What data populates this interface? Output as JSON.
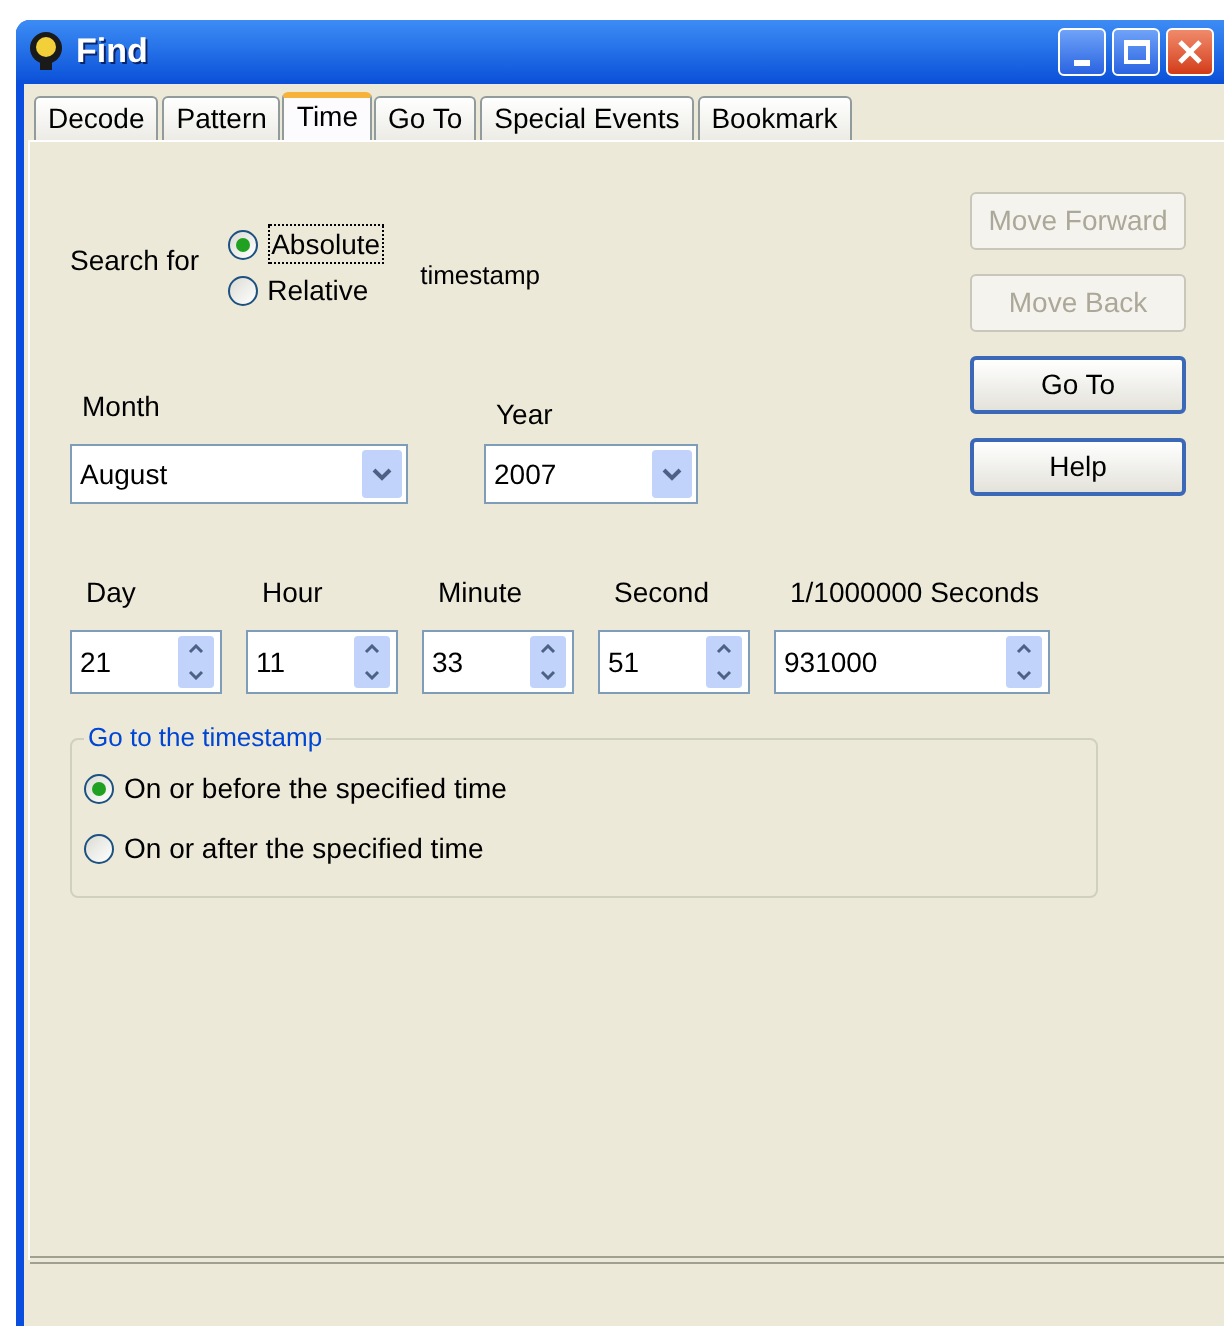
{
  "window": {
    "title": "Find"
  },
  "tabs": [
    {
      "label": "Decode",
      "selected": false
    },
    {
      "label": "Pattern",
      "selected": false
    },
    {
      "label": "Time",
      "selected": true
    },
    {
      "label": "Go To",
      "selected": false
    },
    {
      "label": "Special Events",
      "selected": false
    },
    {
      "label": "Bookmark",
      "selected": false
    }
  ],
  "search_for": {
    "label": "Search for",
    "suffix": "timestamp",
    "options": [
      {
        "label": "Absolute",
        "selected": true
      },
      {
        "label": "Relative",
        "selected": false
      }
    ]
  },
  "month": {
    "label": "Month",
    "value": "August"
  },
  "year": {
    "label": "Year",
    "value": "2007"
  },
  "buttons": [
    {
      "label": "Move Forward",
      "disabled": true
    },
    {
      "label": "Move Back",
      "disabled": true
    },
    {
      "label": "Go To",
      "disabled": false
    },
    {
      "label": "Help",
      "disabled": false
    }
  ],
  "spinners": [
    {
      "label": "Day",
      "value": "21"
    },
    {
      "label": "Hour",
      "value": "11"
    },
    {
      "label": "Minute",
      "value": "33"
    },
    {
      "label": "Second",
      "value": "51"
    },
    {
      "label": "1/1000000 Seconds",
      "value": "931000"
    }
  ],
  "goto_group": {
    "title": "Go to the timestamp",
    "options": [
      {
        "label": "On or before the specified time",
        "selected": true
      },
      {
        "label": "On or after the specified time",
        "selected": false
      }
    ]
  }
}
